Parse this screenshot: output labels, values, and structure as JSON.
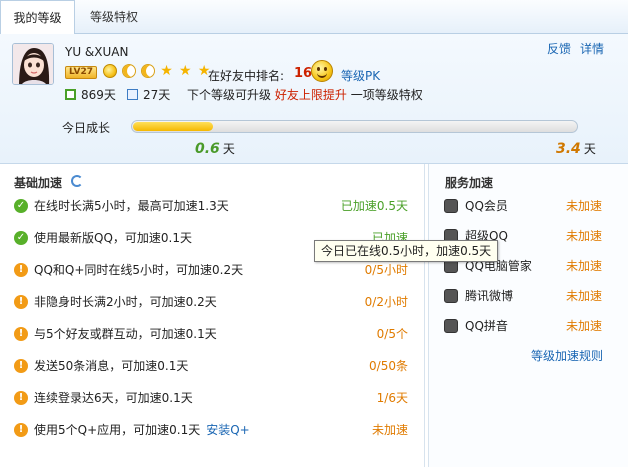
{
  "tabs": [
    {
      "label": "我的等级",
      "active": true
    },
    {
      "label": "等级特权",
      "active": false
    }
  ],
  "profile": {
    "nickname": "YU &XUAN",
    "level_badge": "LV27",
    "level_icons": [
      "sun-icon",
      "moon-icon",
      "moon-icon",
      "star-icon",
      "star-icon",
      "star-icon"
    ],
    "rank_label": "在好友中排名:",
    "rank_value": "16",
    "pk_link": "等级PK",
    "feedback_link": "反馈",
    "detail_link": "详情",
    "active_days": "869天",
    "remaining_days": "27天",
    "next_level_prefix": "下个等级可升级",
    "next_level_highlight": "好友上限提升",
    "next_level_suffix": "一项等级特权"
  },
  "growth": {
    "label": "今日成长",
    "progress": 0.18,
    "current_value": "0.6",
    "max_value": "3.4",
    "unit": "天"
  },
  "basic": {
    "title": "基础加速",
    "rows": [
      {
        "text": "在线时长满5小时，最高可加速1.3天",
        "value": "已加速0.5天",
        "status": "done"
      },
      {
        "text": "使用最新版QQ，可加速0.1天",
        "value": "已加速",
        "status": "done"
      },
      {
        "text": "QQ和Q+同时在线5小时，可加速0.2天",
        "value": "0/5小时",
        "status": "todo"
      },
      {
        "text": "非隐身时长满2小时，可加速0.2天",
        "value": "0/2小时",
        "status": "todo"
      },
      {
        "text": "与5个好友或群互动，可加速0.1天",
        "value": "0/5个",
        "status": "todo"
      },
      {
        "text": "发送50条消息，可加速0.1天",
        "value": "0/50条",
        "status": "todo"
      },
      {
        "text": "连续登录达6天，可加速0.1天",
        "value": "1/6天",
        "status": "todo"
      },
      {
        "text": "使用5个Q+应用，可加速0.1天",
        "value": "未加速",
        "status": "todo",
        "action": "安装Q+"
      }
    ]
  },
  "service": {
    "title": "服务加速",
    "items": [
      {
        "name": "QQ会员",
        "state": "未加速",
        "icon": "qq-vip-icon"
      },
      {
        "name": "超级QQ",
        "state": "未加速",
        "icon": "super-qq-icon"
      },
      {
        "name": "QQ电脑管家",
        "state": "未加速",
        "icon": "pc-manager-icon"
      },
      {
        "name": "腾讯微博",
        "state": "未加速",
        "icon": "weibo-icon"
      },
      {
        "name": "QQ拼音",
        "state": "未加速",
        "icon": "qq-pinyin-icon"
      }
    ],
    "rule_link": "等级加速规则"
  },
  "tooltip": "今日已在线0.5小时，加速0.5天"
}
